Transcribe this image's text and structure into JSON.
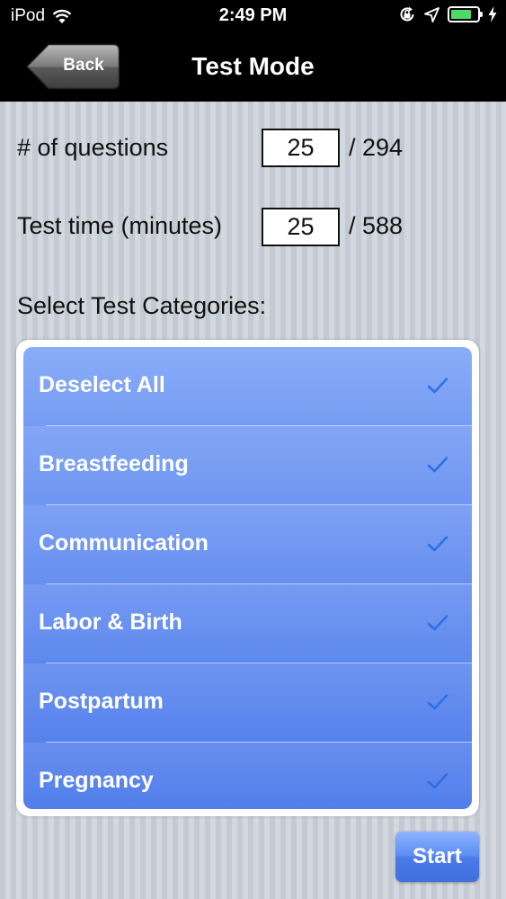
{
  "status_bar": {
    "carrier": "iPod",
    "time": "2:49 PM",
    "battery_level": 0.82,
    "battery_color": "#4cd964"
  },
  "nav": {
    "back_label": "Back",
    "title": "Test Mode"
  },
  "form": {
    "questions": {
      "label": "# of questions",
      "value": "25",
      "total": "/ 294"
    },
    "test_time": {
      "label": "Test time (minutes)",
      "value": "25",
      "total": "/ 588"
    }
  },
  "categories": {
    "heading": "Select Test Categories:",
    "items": [
      {
        "label": "Deselect All",
        "checked": true
      },
      {
        "label": "Breastfeeding",
        "checked": true
      },
      {
        "label": "Communication",
        "checked": true
      },
      {
        "label": "Labor & Birth",
        "checked": true
      },
      {
        "label": "Postpartum",
        "checked": true
      },
      {
        "label": "Pregnancy",
        "checked": true
      }
    ],
    "check_color": "#2f6fe6"
  },
  "start_label": "Start",
  "icons": {
    "wifi": "wifi-icon",
    "orientation_lock": "orientation-lock-icon",
    "location": "location-arrow-icon",
    "battery": "battery-icon",
    "charging": "charging-bolt-icon",
    "check": "checkmark-icon"
  }
}
